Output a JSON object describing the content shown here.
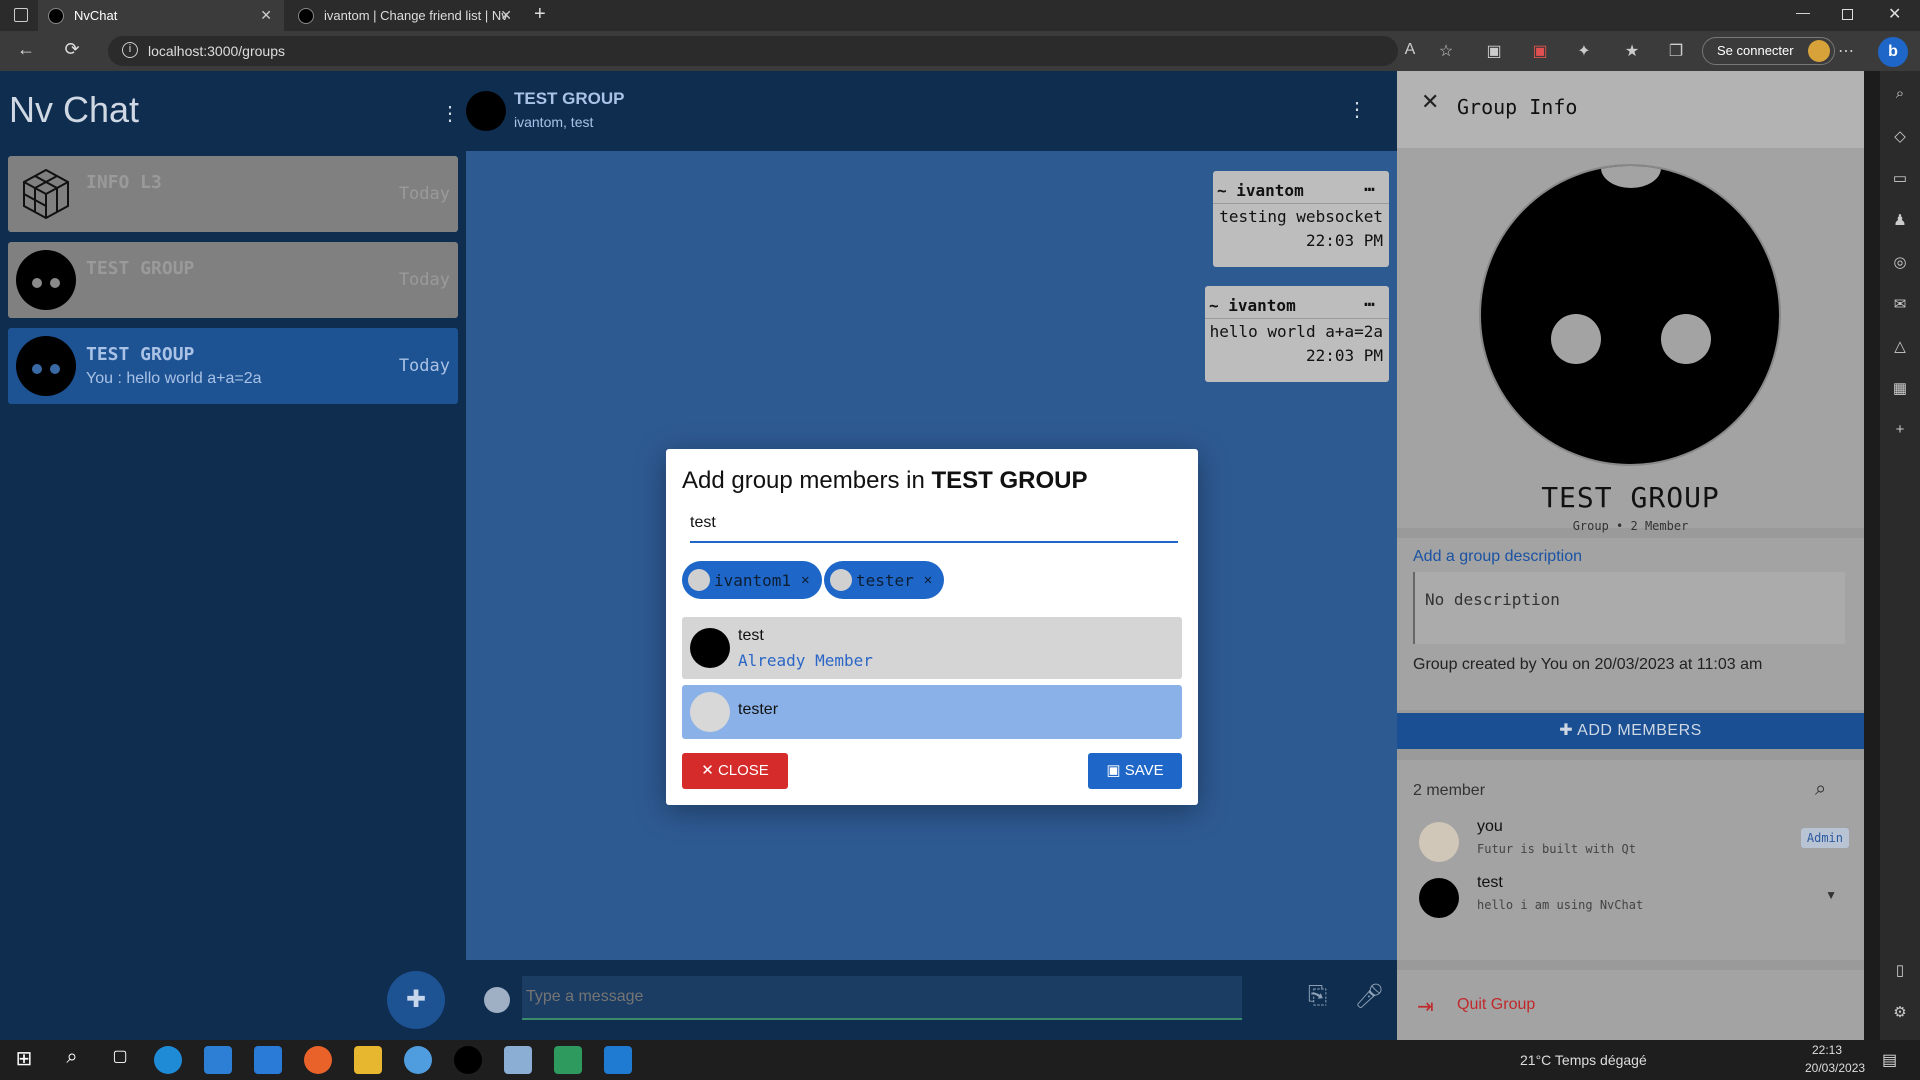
{
  "browser": {
    "tabs": [
      {
        "label": "NvChat",
        "active": true
      },
      {
        "label": "ivantom | Change friend list | Nv",
        "active": false
      }
    ],
    "url": "localhost:3000/groups",
    "signin_label": "Se connecter"
  },
  "sidebar": {
    "brand": "Nv Chat",
    "chats": [
      {
        "name": "INFO L3",
        "preview": "",
        "time": "Today",
        "selected": false
      },
      {
        "name": "TEST GROUP",
        "preview": "",
        "time": "Today",
        "selected": false
      },
      {
        "name": "TEST GROUP",
        "preview": "You : hello world a+a=2a",
        "time": "Today",
        "selected": true
      }
    ]
  },
  "chat": {
    "title": "TEST GROUP",
    "subtitle": "ivantom, test",
    "messages": [
      {
        "author": "~ ivantom",
        "text": "testing websocket",
        "time": "22:03 PM"
      },
      {
        "author": "~ ivantom",
        "text": "hello world a+a=2a",
        "time": "22:03 PM"
      }
    ],
    "composer_placeholder": "Type a message"
  },
  "group_info": {
    "header": "Group Info",
    "name": "TEST GROUP",
    "meta": "Group • 2 Member",
    "add_description_label": "Add a group description",
    "description_placeholder": "No description",
    "created_text": "Group created by You on 20/03/2023 at 11:03 am",
    "add_members_label": "ADD MEMBERS",
    "members_count": "2 member",
    "members": [
      {
        "name": "you",
        "status": "Futur is built with Qt",
        "badge": "Admin"
      },
      {
        "name": "test",
        "status": "hello i am using NvChat",
        "badge": ""
      }
    ],
    "quit_label": "Quit Group"
  },
  "modal": {
    "title_prefix": "Add group members in ",
    "title_group": "TEST GROUP",
    "search_value": "test",
    "chips": [
      "ivantom1",
      "tester"
    ],
    "results": [
      {
        "name": "test",
        "status": "Already Member"
      },
      {
        "name": "tester",
        "status": ""
      }
    ],
    "close_label": "CLOSE",
    "save_label": "SAVE"
  },
  "taskbar": {
    "weather": "21°C  Temps dégagé",
    "time": "22:13",
    "date": "20/03/2023"
  },
  "colors": {
    "accent": "#1e66c7",
    "sidebar_bg": "#0e2d4f",
    "chat_bg": "#2e5a92",
    "danger": "#d62b2b"
  }
}
